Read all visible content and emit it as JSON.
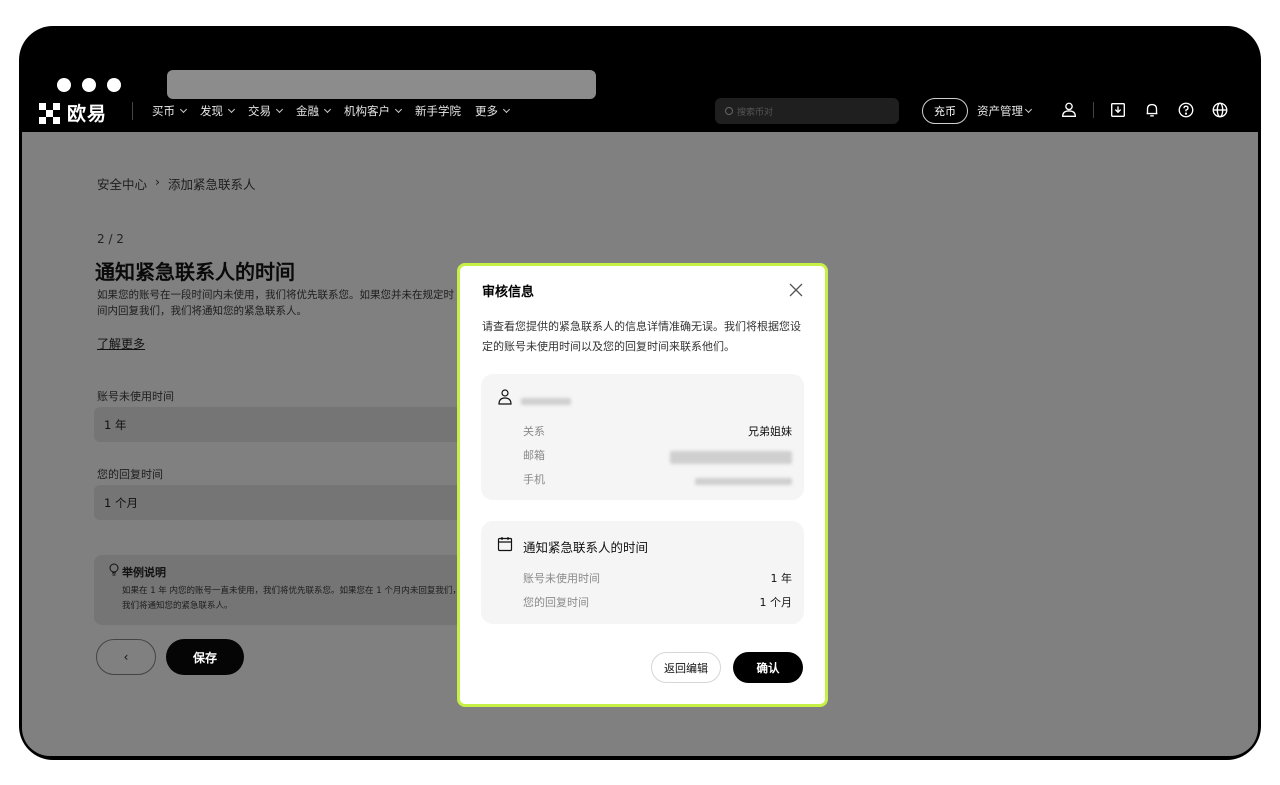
{
  "nav": {
    "logo_text": "欧易",
    "menu": [
      "买币",
      "发现",
      "交易",
      "金融",
      "机构客户",
      "新手学院",
      "更多"
    ],
    "search_placeholder": "搜索币对",
    "deposit_label": "充币",
    "assets_label": "资产管理",
    "icons": [
      "user-icon",
      "download-icon",
      "bell-icon",
      "help-icon",
      "globe-icon"
    ]
  },
  "page": {
    "breadcrumb": {
      "parent": "安全中心",
      "separator": "›",
      "current": "添加紧急联系人"
    },
    "step": "2 / 2",
    "title": "通知紧急联系人的时间",
    "description": "如果您的账号在一段时间内未使用，我们将优先联系您。如果您并未在规定时间内回复我们，我们将通知您的紧急联系人。",
    "learn_more": "了解更多",
    "unused_label": "账号未使用时间",
    "unused_value": "1 年",
    "reply_label": "您的回复时间",
    "reply_value": "1 个月",
    "example_title": "举例说明",
    "example_text": "如果在 1 年 内您的账号一直未使用，我们将优先联系您。如果您在 1 个月内未回复我们，我们将通知您的紧急联系人。",
    "back_label": "‹",
    "save_label": "保存"
  },
  "modal": {
    "title": "审核信息",
    "description": "请查看您提供的紧急联系人的信息详情准确无误。我们将根据您设定的账号未使用时间以及您的回复时间来联系他们。",
    "contact": {
      "relation_label": "关系",
      "relation_value": "兄弟姐妹",
      "email_label": "邮箱",
      "phone_label": "手机"
    },
    "timing": {
      "title": "通知紧急联系人的时间",
      "unused_label": "账号未使用时间",
      "unused_value": "1 年",
      "reply_label": "您的回复时间",
      "reply_value": "1 个月"
    },
    "edit_label": "返回编辑",
    "confirm_label": "确认"
  },
  "colors": {
    "accent": "#c6f046",
    "overlay": "#808080",
    "dark": "#000000"
  }
}
